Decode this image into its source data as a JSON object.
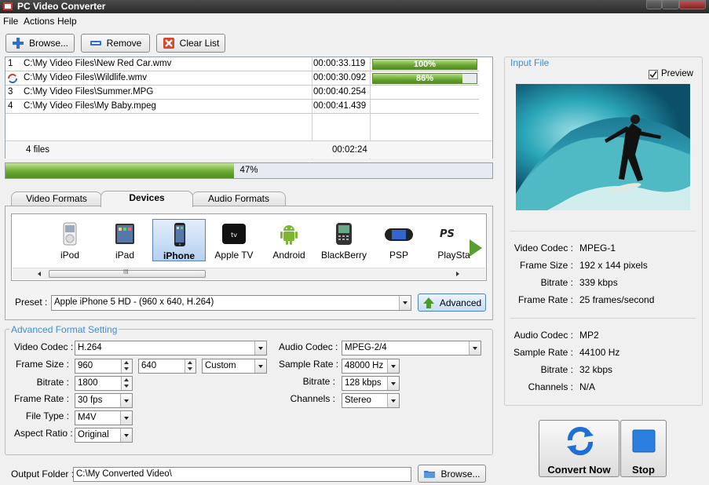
{
  "window": {
    "title": "PC Video Converter"
  },
  "menu": [
    {
      "label": "File",
      "key": "F"
    },
    {
      "label": "Actions",
      "key": "A"
    },
    {
      "label": "Help",
      "key": "H"
    }
  ],
  "toolbar": {
    "browse": "Browse...",
    "remove": "Remove",
    "clear": "Clear List"
  },
  "files": [
    {
      "index": "1",
      "path": "C:\\My Video Files\\New Red Car.wmv",
      "duration": "00:00:33.119",
      "progress_label": "100%",
      "progress": 1.0
    },
    {
      "index": "",
      "path": "C:\\My Video Files\\Wildlife.wmv",
      "duration": "00:00:30.092",
      "progress_label": "86%",
      "progress": 0.86
    },
    {
      "index": "3",
      "path": "C:\\My Video Files\\Summer.MPG",
      "duration": "00:00:40.254",
      "progress_label": "",
      "progress": 0
    },
    {
      "index": "4",
      "path": "C:\\My Video Files\\My Baby.mpeg",
      "duration": "00:00:41.439",
      "progress_label": "",
      "progress": 0
    }
  ],
  "summary": {
    "count": "4 files",
    "total": "00:02:24"
  },
  "overall": {
    "label": "47%",
    "progress": 0.47
  },
  "tabs": [
    "Video Formats",
    "Devices",
    "Audio Formats"
  ],
  "devices": [
    {
      "label": "iPod",
      "icon": "ipod-icon"
    },
    {
      "label": "iPad",
      "icon": "ipad-icon"
    },
    {
      "label": "iPhone",
      "icon": "iphone-icon"
    },
    {
      "label": "Apple TV",
      "icon": "appletv-icon"
    },
    {
      "label": "Android",
      "icon": "android-icon"
    },
    {
      "label": "BlackBerry",
      "icon": "blackberry-icon"
    },
    {
      "label": "PSP",
      "icon": "psp-icon"
    },
    {
      "label": "PlaySta",
      "icon": "playstation-icon"
    }
  ],
  "device_scroll_grip": "III",
  "appletv_badge": "tv",
  "ps_logo": "PS",
  "preset": {
    "label": "Preset :",
    "value": "Apple iPhone 5 HD - (960 x 640, H.264)",
    "advanced": "Advanced"
  },
  "advanced": {
    "title": "Advanced Format Setting",
    "video_codec_label": "Video Codec :",
    "video_codec": "H.264",
    "frame_size_label": "Frame Size :",
    "width": "960",
    "height": "640",
    "size_mode": "Custom",
    "bitrate_label": "Bitrate :",
    "bitrate": "1800",
    "frame_rate_label": "Frame Rate :",
    "frame_rate": "30 fps",
    "file_type_label": "File Type :",
    "file_type": "M4V",
    "aspect_label": "Aspect Ratio :",
    "aspect": "Original",
    "audio_codec_label": "Audio Codec :",
    "audio_codec": "MPEG-2/4",
    "sample_rate_label": "Sample Rate :",
    "sample_rate": "48000 Hz",
    "audio_bitrate_label": "Bitrate :",
    "audio_bitrate": "128 kbps",
    "channels_label": "Channels :",
    "channels": "Stereo"
  },
  "output": {
    "label": "Output Folder :",
    "path": "C:\\My Converted Video\\",
    "browse": "Browse..."
  },
  "input_file": {
    "title": "Input File",
    "preview": "Preview",
    "video_codec_label": "Video Codec :",
    "video_codec": "MPEG-1",
    "frame_size_label": "Frame Size :",
    "frame_size": "192 x 144 pixels",
    "bitrate_label": "Bitrate :",
    "bitrate": "339 kbps",
    "frame_rate_label": "Frame Rate :",
    "frame_rate": "25 frames/second",
    "audio_codec_label": "Audio Codec :",
    "audio_codec": "MP2",
    "sample_rate_label": "Sample Rate :",
    "sample_rate": "44100 Hz",
    "audio_bitrate_label": "Bitrate :",
    "audio_bitrate": "32 kbps",
    "channels_label": "Channels :",
    "channels": "N/A"
  },
  "actions": {
    "convert": "Convert Now",
    "stop": "Stop"
  },
  "colors": {
    "accent_blue": "#3b8ed8",
    "progress_green": "#67a531",
    "selection": "#b5d0ef"
  }
}
